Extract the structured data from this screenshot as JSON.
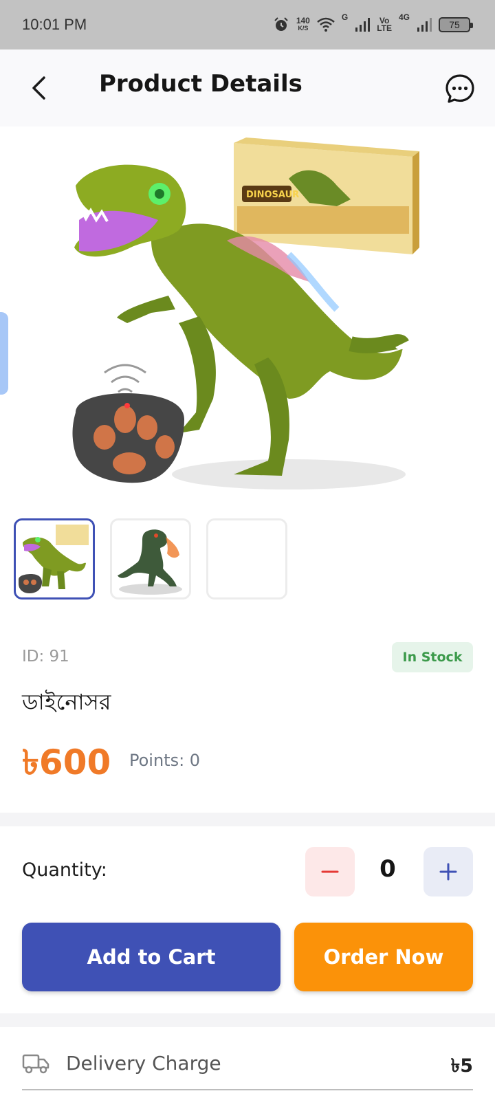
{
  "status_bar": {
    "time": "10:01 PM",
    "net_speed_top": "140",
    "net_speed_unit": "K/S",
    "sim1_label": "G",
    "volte_top": "Vo",
    "volte_bottom": "LTE",
    "sim2_label": "4G",
    "battery": "75"
  },
  "app_bar": {
    "title": "Product Details",
    "back_icon": "chevron-left-icon",
    "chat_icon": "chat-bubble-icon"
  },
  "gallery": {
    "thumbnails": [
      {
        "selected": true,
        "image": "dinosaur-with-remote-and-box"
      },
      {
        "selected": false,
        "image": "dinosaur-breathing-fire"
      },
      {
        "selected": false,
        "image": "empty"
      }
    ]
  },
  "product": {
    "id": "ID: 91",
    "stock": "In Stock",
    "name": "ডাইনোসর",
    "price": "৳600",
    "points": "Points: 0"
  },
  "quantity": {
    "label": "Quantity:",
    "value": "0",
    "minus_icon": "minus-icon",
    "plus_icon": "plus-icon"
  },
  "actions": {
    "add_to_cart": "Add to Cart",
    "order_now": "Order Now"
  },
  "delivery": {
    "icon": "truck-icon",
    "label": "Delivery Charge",
    "value": "৳5"
  },
  "colors": {
    "primary": "#3f51b5",
    "order": "#fb9209",
    "price": "#f07a28",
    "stock_text": "#3c9a4b",
    "stock_bg": "#e6f4ea"
  }
}
